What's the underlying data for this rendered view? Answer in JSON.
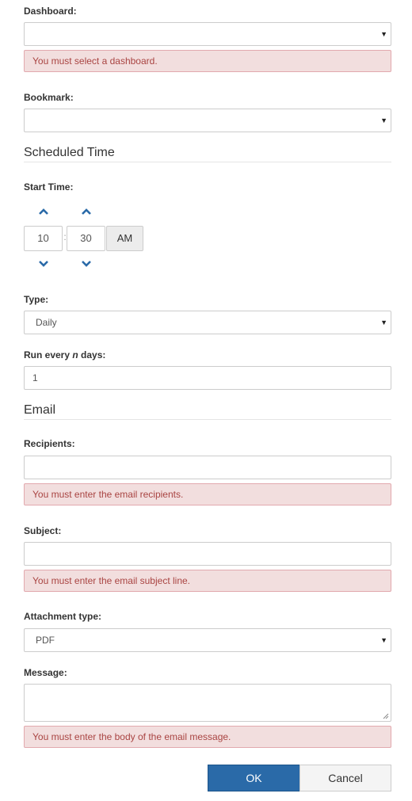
{
  "dashboard": {
    "label": "Dashboard:",
    "value": "",
    "error": "You must select a dashboard."
  },
  "bookmark": {
    "label": "Bookmark:",
    "value": ""
  },
  "scheduled_time": {
    "title": "Scheduled Time",
    "start_time_label": "Start Time:",
    "hour": "10",
    "separator": ":",
    "minute": "30",
    "meridiem": "AM"
  },
  "type": {
    "label": "Type:",
    "value": "Daily"
  },
  "run_every": {
    "label_prefix": "Run every ",
    "label_n": "n",
    "label_suffix": " days:",
    "value": "1"
  },
  "email": {
    "title": "Email",
    "recipients_label": "Recipients:",
    "recipients_value": "",
    "recipients_error": "You must enter the email recipients.",
    "subject_label": "Subject:",
    "subject_value": "",
    "subject_error": "You must enter the email subject line.",
    "attachment_label": "Attachment type:",
    "attachment_value": "PDF",
    "message_label": "Message:",
    "message_value": "",
    "message_error": "You must enter the body of the email message."
  },
  "buttons": {
    "ok": "OK",
    "cancel": "Cancel"
  },
  "colors": {
    "error_bg": "#f2dede",
    "error_text": "#a94442",
    "primary": "#2a6aa8",
    "spinner": "#2a6aa8"
  },
  "icons": {
    "dropdown": "caret-down-icon",
    "increment": "chevron-up-icon",
    "decrement": "chevron-down-icon",
    "resize": "resize-grip-icon"
  }
}
